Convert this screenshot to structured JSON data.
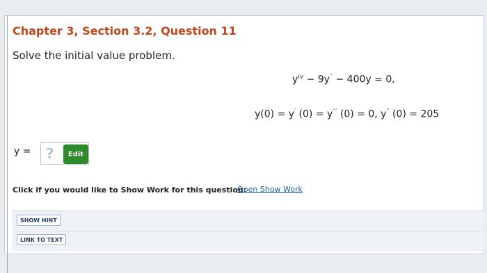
{
  "question": {
    "title": "Chapter 3, Section 3.2, Question 11",
    "prompt": "Solve the initial value problem.",
    "equation_1": "y^iv − 9y'' − 400y = 0,",
    "equation_2": "y(0) = y'(0) = y'''(0) = 0, y''(0) = 205"
  },
  "answer": {
    "label": "y =",
    "placeholder_icon": "?",
    "edit_button": "Edit"
  },
  "show_work": {
    "prompt": "Click if you would like to Show Work for this question:",
    "link": "Open Show Work"
  },
  "buttons": {
    "hint": "SHOW HINT",
    "text_link": "LINK TO TEXT"
  }
}
